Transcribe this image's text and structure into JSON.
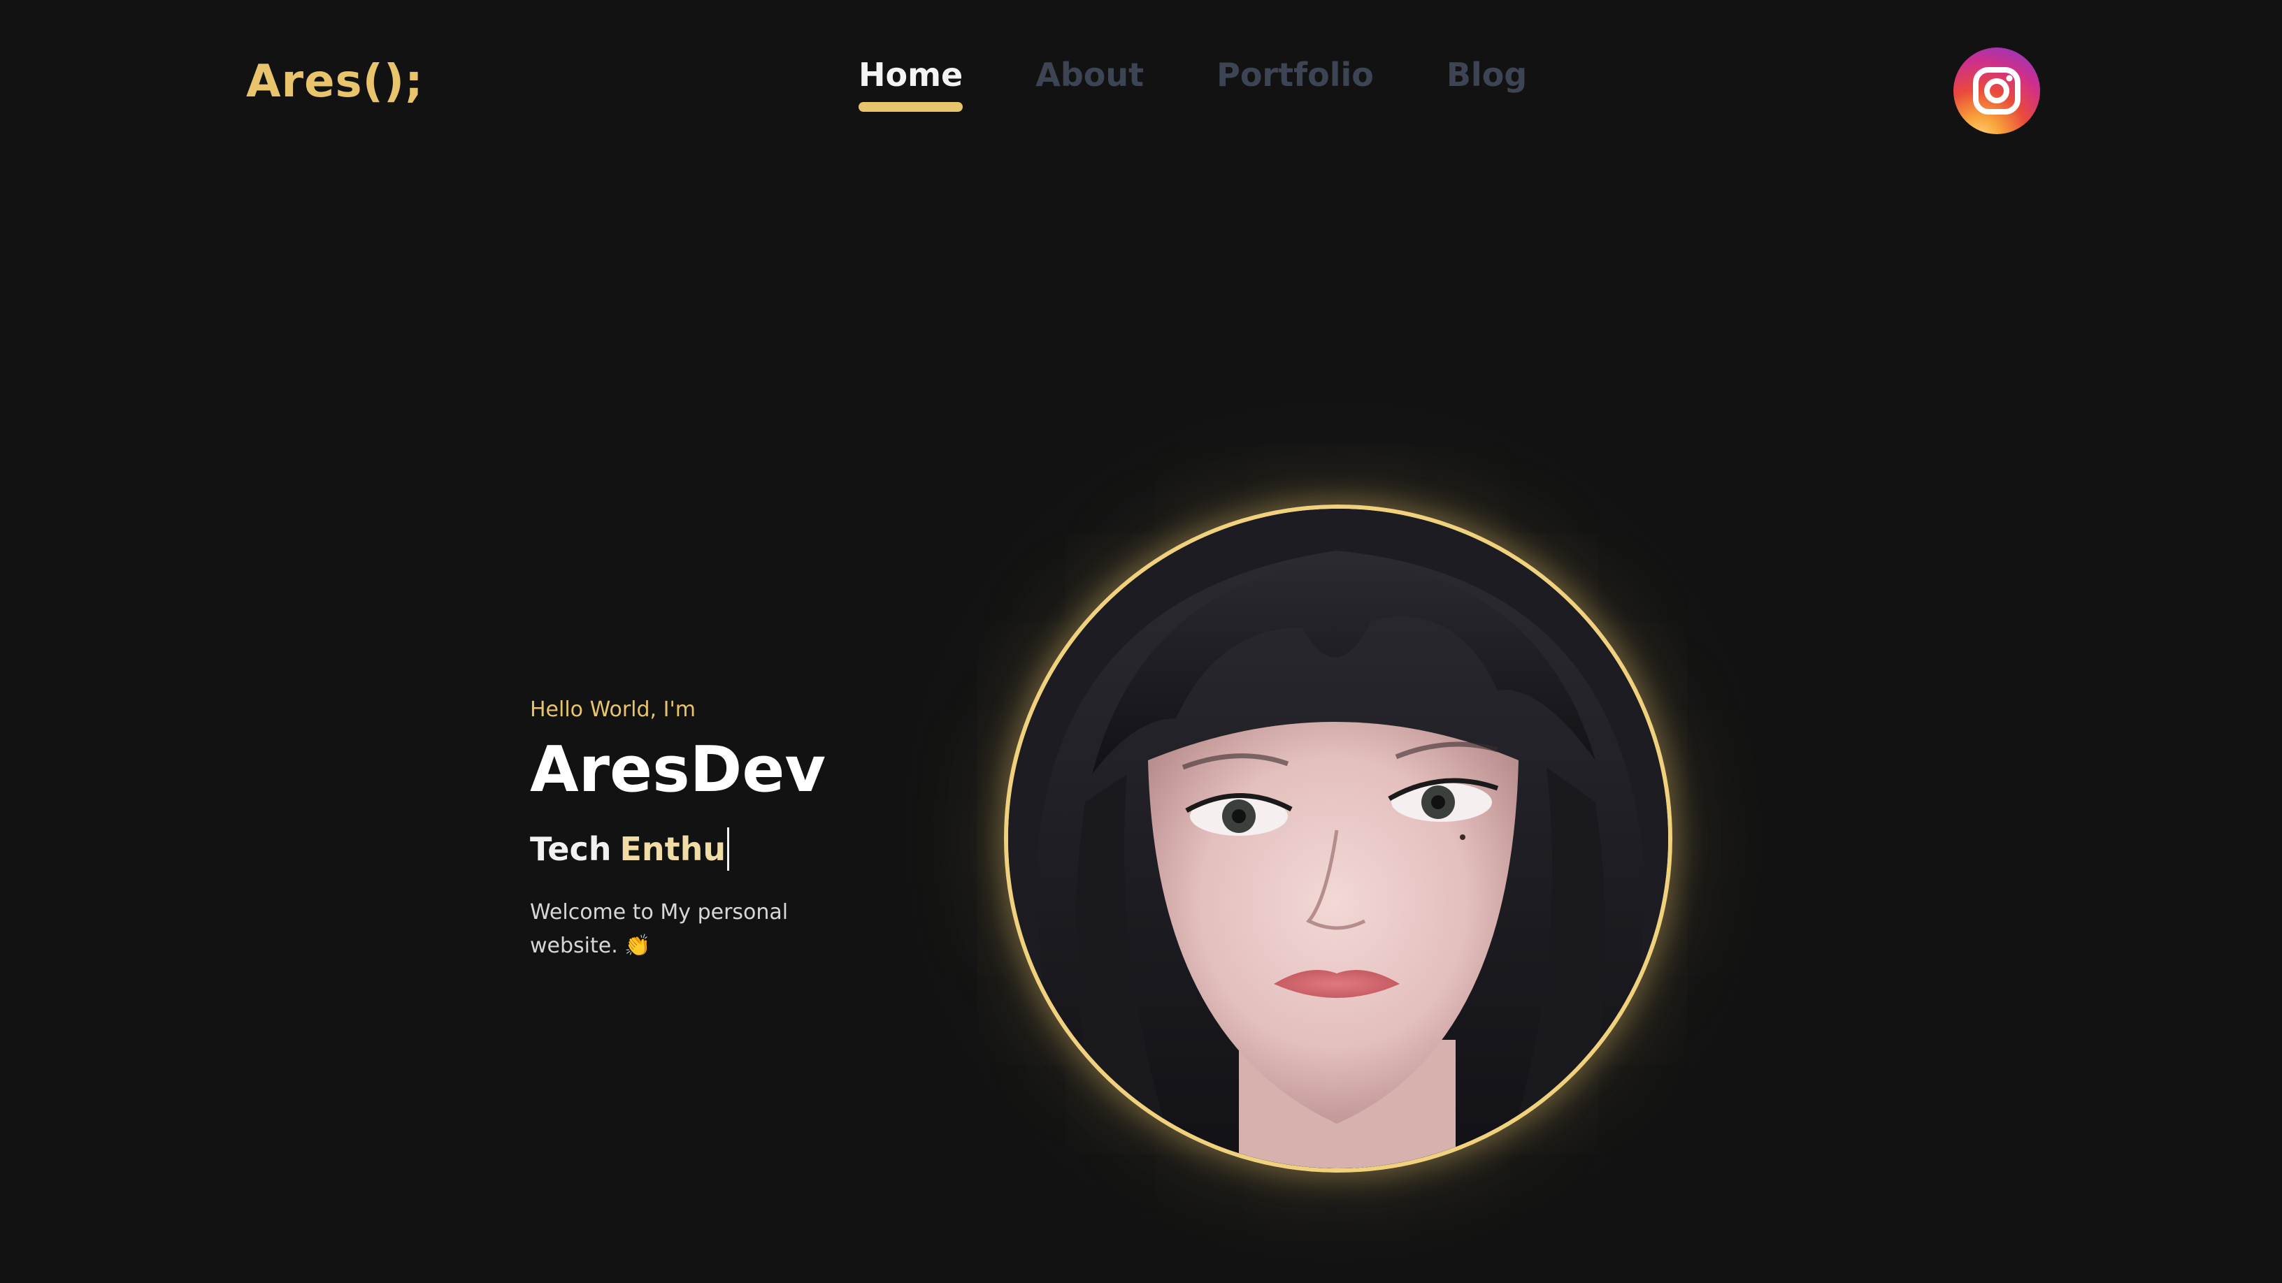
{
  "brand": {
    "logo_text": "Ares();"
  },
  "nav": {
    "items": [
      {
        "label": "Home",
        "active": true
      },
      {
        "label": "About",
        "active": false
      },
      {
        "label": "Portfolio",
        "active": false
      },
      {
        "label": "Blog",
        "active": false
      }
    ]
  },
  "social": {
    "icon": "instagram-icon"
  },
  "hero": {
    "greeting": "Hello World, I'm",
    "name": "AresDev",
    "role_static": "Tech",
    "role_typed": "Enthu",
    "welcome": "Welcome to My personal website. 👏"
  },
  "avatar": {
    "icon": "portrait-illustration"
  },
  "colors": {
    "background": "#121212",
    "accent": "#e8c46c",
    "nav_inactive": "#3d4555",
    "text": "#ffffff"
  }
}
